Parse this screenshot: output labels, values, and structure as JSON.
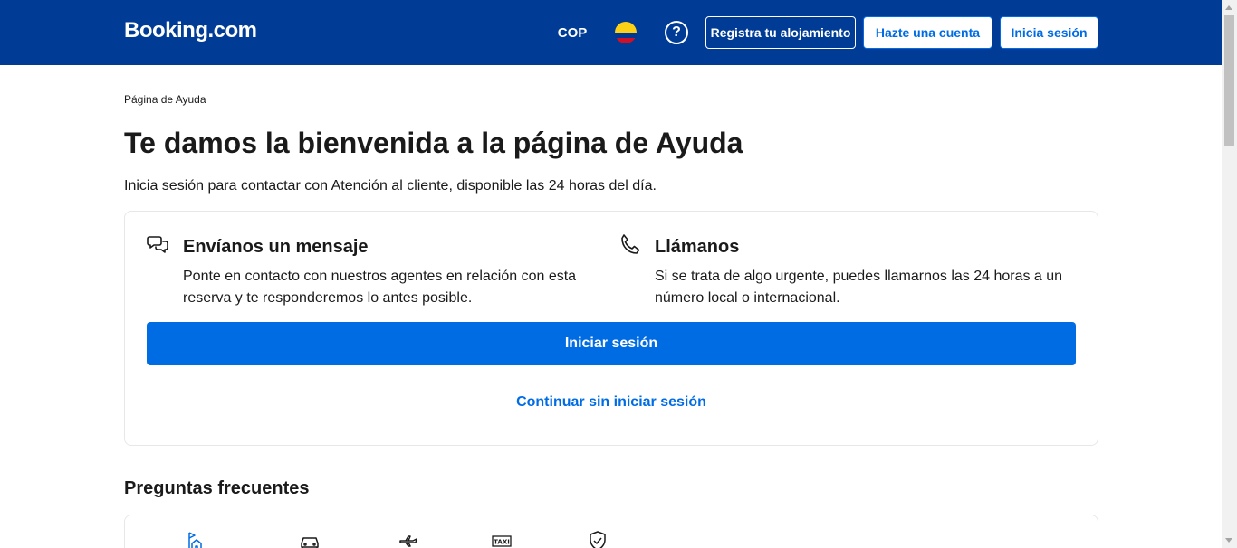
{
  "header": {
    "logo": "Booking.com",
    "currency": "COP",
    "help_symbol": "?",
    "list_property": "Registra tu alojamiento",
    "register": "Hazte una cuenta",
    "sign_in": "Inicia sesión",
    "flag_icon": "colombia-flag-icon"
  },
  "breadcrumb": "Página de Ayuda",
  "page_title": "Te damos la bienvenida a la página de Ayuda",
  "subtitle": "Inicia sesión para contactar con Atención al cliente, disponible las 24 horas del día.",
  "contact": {
    "message": {
      "title": "Envíanos un mensaje",
      "text": "Ponte en contacto con nuestros agentes en relación con esta reserva y te responderemos lo antes posible.",
      "icon": "chat-bubbles-icon"
    },
    "call": {
      "title": "Llámanos",
      "text": "Si se trata de algo urgente, puedes llamarnos las 24 horas a un número local o internacional.",
      "icon": "phone-icon"
    },
    "signin_button": "Iniciar sesión",
    "continue_link": "Continuar sin iniciar sesión"
  },
  "faq": {
    "title": "Preguntas frecuentes",
    "categories": [
      {
        "icon": "stays-icon"
      },
      {
        "icon": "car-rental-icon"
      },
      {
        "icon": "flight-icon"
      },
      {
        "icon": "taxi-icon"
      },
      {
        "icon": "insurance-shield-icon"
      }
    ],
    "taxi_label": "TAXI"
  },
  "colors": {
    "brand_blue": "#003b95",
    "action_blue": "#006ce4",
    "flag_yellow": "#fcd116",
    "flag_blue": "#003893",
    "flag_red": "#ce1126"
  }
}
